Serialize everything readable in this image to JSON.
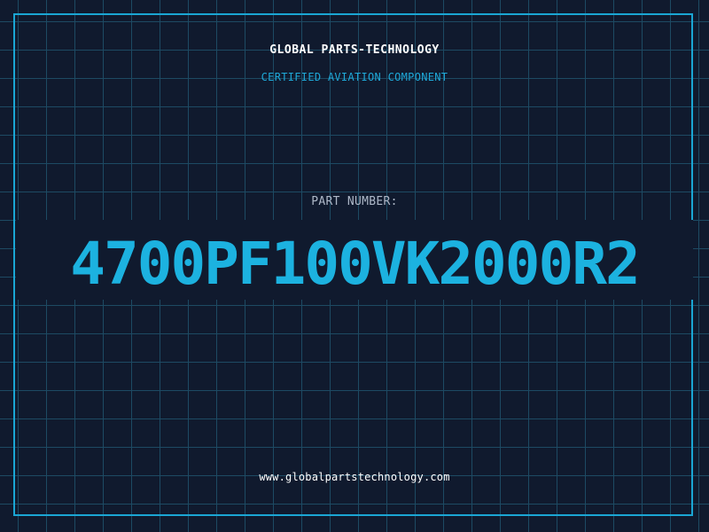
{
  "header": {
    "company": "GLOBAL PARTS-TECHNOLOGY",
    "subtitle": "CERTIFIED AVIATION COMPONENT"
  },
  "part": {
    "label": "PART NUMBER:",
    "number": "4700PF100VK2000R2"
  },
  "footer": {
    "website": "www.globalpartstechnology.com"
  },
  "colors": {
    "background": "#101a2e",
    "grid": "#1d4a63",
    "frame": "#1aa6d4",
    "accent": "#1cb2e0",
    "label": "#aeb8c8",
    "text": "#ffffff"
  }
}
